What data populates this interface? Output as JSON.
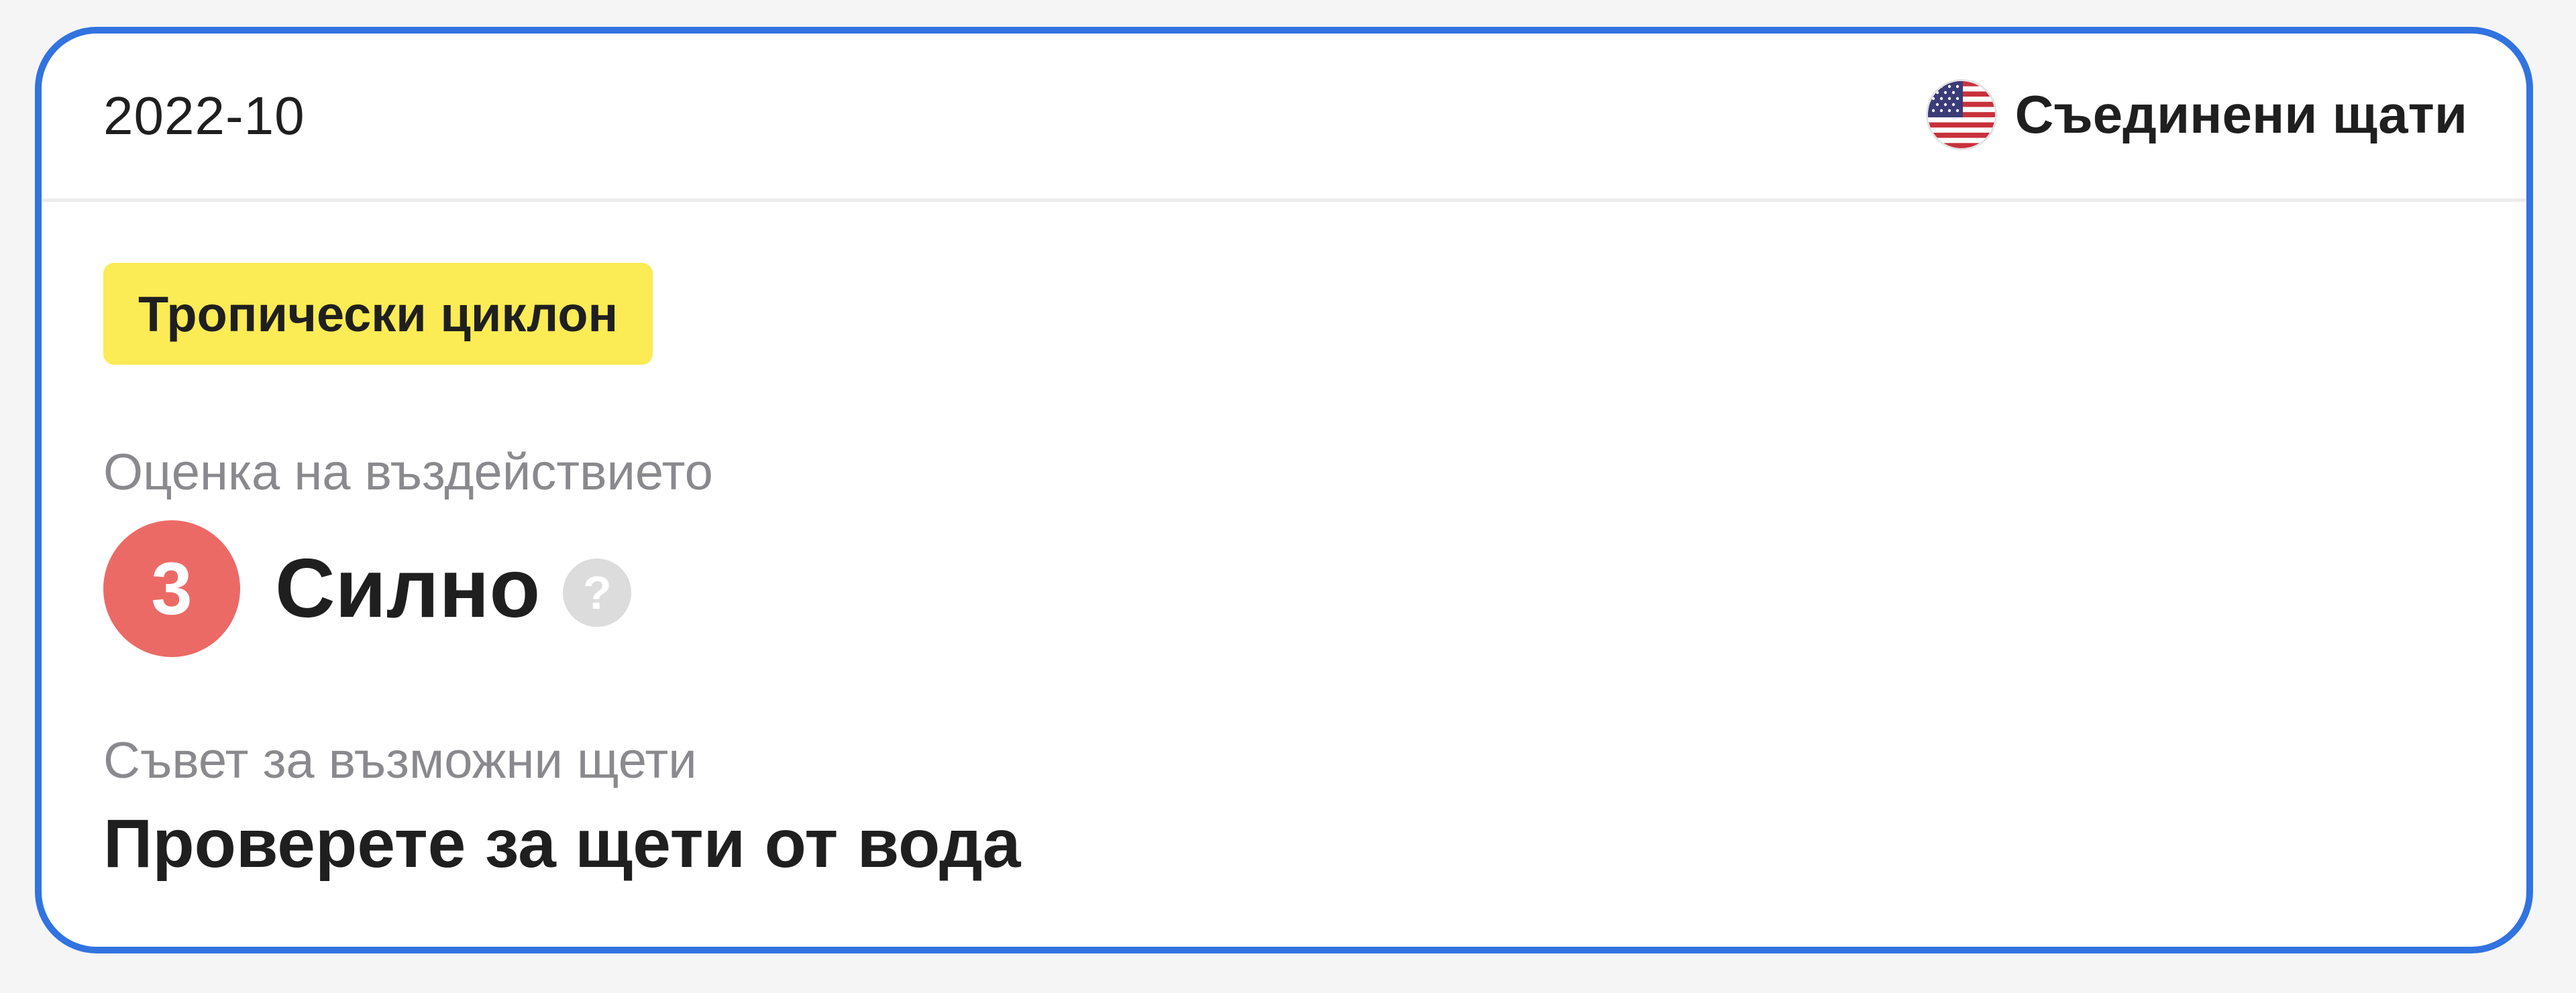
{
  "card": {
    "date": "2022-10",
    "country": {
      "name": "Съединени щати",
      "flag_icon": "us-flag-icon"
    },
    "event_tag": "Тропически циклон",
    "impact": {
      "label": "Оценка на въздействието",
      "level": "3",
      "level_text": "Силно",
      "help_icon": "question-mark-icon",
      "help_glyph": "?"
    },
    "advice": {
      "label": "Съвет за възможни щети",
      "text": "Проверете за щети от вода"
    }
  },
  "colors": {
    "border": "#3173e0",
    "tag_background": "#fbeb55",
    "impact_badge": "#ec6a65",
    "help_icon": "#dcdcdc"
  }
}
